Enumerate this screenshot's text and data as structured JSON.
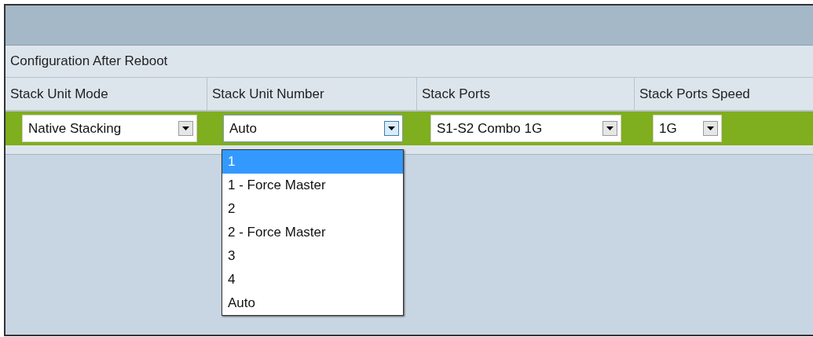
{
  "section": {
    "title": "Configuration After Reboot"
  },
  "columns": [
    {
      "label": "Stack Unit Mode",
      "value": "Native Stacking",
      "expanded": false
    },
    {
      "label": "Stack Unit Number",
      "value": "Auto",
      "expanded": true
    },
    {
      "label": "Stack Ports",
      "value": "S1-S2 Combo 1G",
      "expanded": false
    },
    {
      "label": "Stack Ports Speed",
      "value": "1G",
      "expanded": false
    }
  ],
  "dropdown": {
    "options": [
      {
        "label": "1",
        "selected": true
      },
      {
        "label": "1 - Force Master",
        "selected": false
      },
      {
        "label": "2",
        "selected": false
      },
      {
        "label": "2 - Force Master",
        "selected": false
      },
      {
        "label": "3",
        "selected": false
      },
      {
        "label": "4",
        "selected": false
      },
      {
        "label": "Auto",
        "selected": false
      }
    ]
  }
}
